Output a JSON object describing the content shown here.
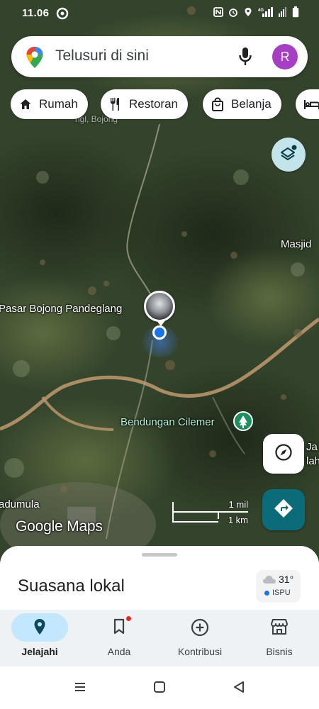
{
  "status_bar": {
    "time": "11.06",
    "icons": [
      "nfc-icon",
      "alarm-icon",
      "location-icon",
      "signal-4g-icon",
      "wifi-icon",
      "battery-icon"
    ]
  },
  "search": {
    "placeholder": "Telusuri di sini",
    "avatar_letter": "R"
  },
  "chips": [
    {
      "label": "Rumah",
      "icon": "home-icon"
    },
    {
      "label": "Restoran",
      "icon": "restaurant-icon"
    },
    {
      "label": "Belanja",
      "icon": "shopping-bag-icon"
    },
    {
      "label": "",
      "icon": "hotel-icon"
    }
  ],
  "map": {
    "labels": {
      "pasar": "Pasar Bojong Pandeglang",
      "masjid": "Masjid",
      "bendungan": "Bendungan Cilemer",
      "adumula": "adumula",
      "ja": "Ja",
      "lah": "lah",
      "bojong_partial": "ngl, Bojong"
    },
    "scale": {
      "top": "1 mil",
      "bottom": "1 km"
    },
    "logo": "Google Maps"
  },
  "sheet": {
    "title": "Suasana lokal",
    "weather": {
      "temp": "31°",
      "aqi": "ISPU"
    }
  },
  "nav": [
    {
      "label": "Jelajahi",
      "icon": "explore-pin-icon",
      "active": true
    },
    {
      "label": "Anda",
      "icon": "bookmark-icon",
      "active": false
    },
    {
      "label": "Kontribusi",
      "icon": "add-circle-icon",
      "active": false
    },
    {
      "label": "Bisnis",
      "icon": "storefront-icon",
      "active": false
    }
  ],
  "colors": {
    "accent": "#1a73e8",
    "directions": "#0b6b79",
    "layers_button": "#c4e4ec",
    "avatar": "#a73fc4",
    "active_nav": "#c2e7ff"
  }
}
